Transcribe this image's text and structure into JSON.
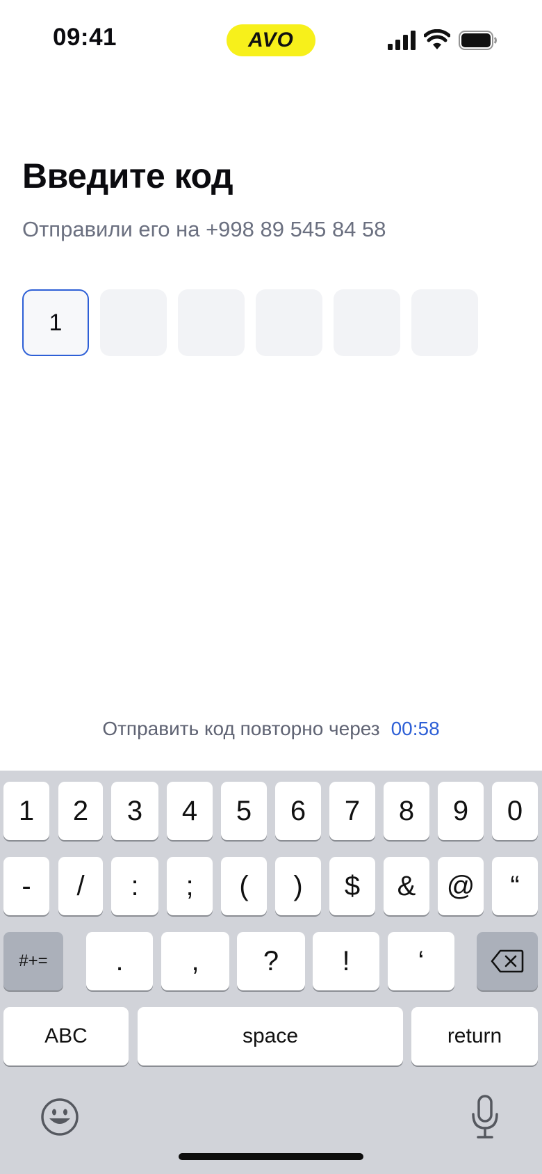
{
  "status_bar": {
    "time": "09:41",
    "brand": "AVO",
    "brand_color": "#f7f01b",
    "icons": [
      "signal-icon",
      "wifi-icon",
      "battery-icon"
    ]
  },
  "screen": {
    "title": "Введите код",
    "subtitle": "Отправили его на +998 89 545 84 58",
    "code_digits": [
      "1",
      "",
      "",
      "",
      "",
      ""
    ],
    "resend_label": "Отправить код повторно через",
    "resend_timer": "00:58",
    "accent_color": "#2d5fd6"
  },
  "keyboard": {
    "row1": [
      "1",
      "2",
      "3",
      "4",
      "5",
      "6",
      "7",
      "8",
      "9",
      "0"
    ],
    "row2": [
      "-",
      "/",
      ":",
      ";",
      "(",
      ")",
      "$",
      "&",
      "@",
      "“"
    ],
    "row3_left": "#+=",
    "row3": [
      ".",
      ",",
      "?",
      "!",
      "‘"
    ],
    "row3_right_icon": "backspace-icon",
    "abc": "ABC",
    "space": "space",
    "return": "return",
    "bottom_icons": [
      "emoji-icon",
      "mic-icon"
    ]
  }
}
